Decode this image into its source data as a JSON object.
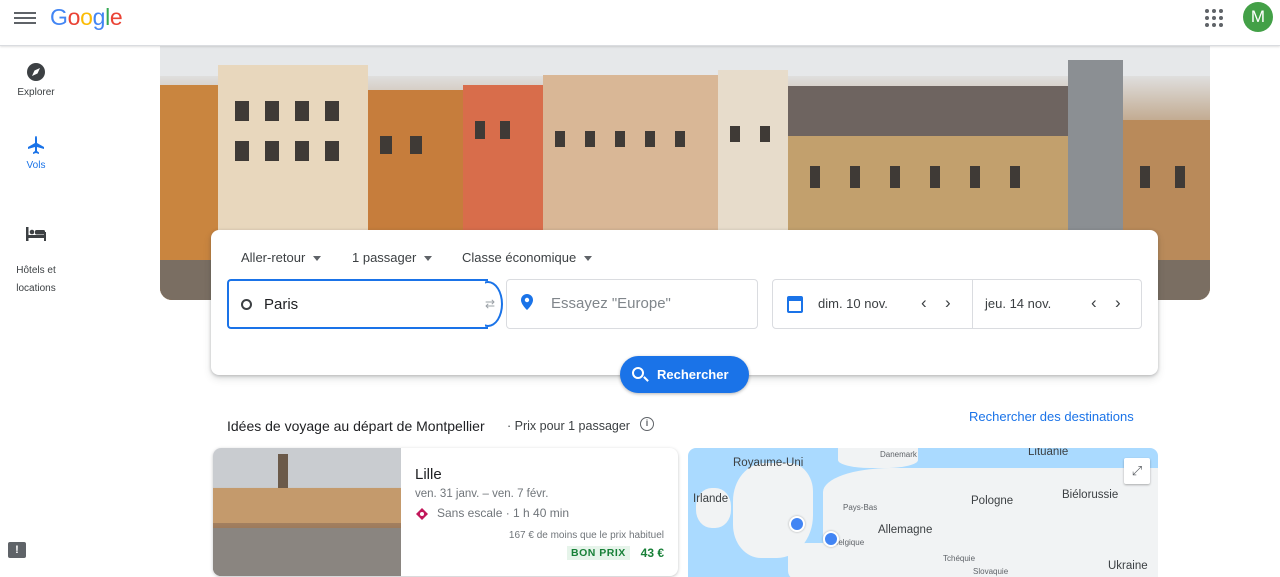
{
  "header": {
    "logo": [
      "G",
      "o",
      "o",
      "g",
      "l",
      "e"
    ],
    "avatar_initial": "M"
  },
  "sidebar": {
    "items": [
      {
        "label": "Explorer",
        "icon": "compass-icon"
      },
      {
        "label": "Vols",
        "icon": "plane-icon",
        "active": true
      },
      {
        "label": "Hôtels et\nlocations",
        "icon": "bed-icon"
      }
    ]
  },
  "search": {
    "trip_type": "Aller-retour",
    "passengers": "1 passager",
    "cabin_class": "Classe économique",
    "origin_value": "Paris",
    "destination_placeholder": "Essayez \"Europe\"",
    "depart_date": "dim. 10 nov.",
    "return_date": "jeu. 14 nov.",
    "search_label": "Rechercher"
  },
  "ideas": {
    "title": "Idées de voyage au départ de Montpellier",
    "subtitle": "· Prix pour 1 passager",
    "explore_link": "Rechercher des destinations",
    "card": {
      "city": "Lille",
      "dates": "ven. 31 janv. – ven. 7 févr.",
      "route": "Sans escale · 1 h 40 min",
      "note": "167 € de moins que le prix habituel",
      "badge": "BON PRIX",
      "price": "43 €"
    }
  },
  "map": {
    "labels": [
      "Royaume-Uni",
      "Irlande",
      "Pologne",
      "Biélorussie",
      "Allemagne",
      "Lituanie",
      "Ukraine"
    ],
    "small_labels": [
      "Danemark",
      "Pays-Bas",
      "Belgique",
      "Tchéquie",
      "Slovaquie"
    ]
  },
  "colors": {
    "accent": "#1a73e8",
    "good_price": "#188038"
  }
}
